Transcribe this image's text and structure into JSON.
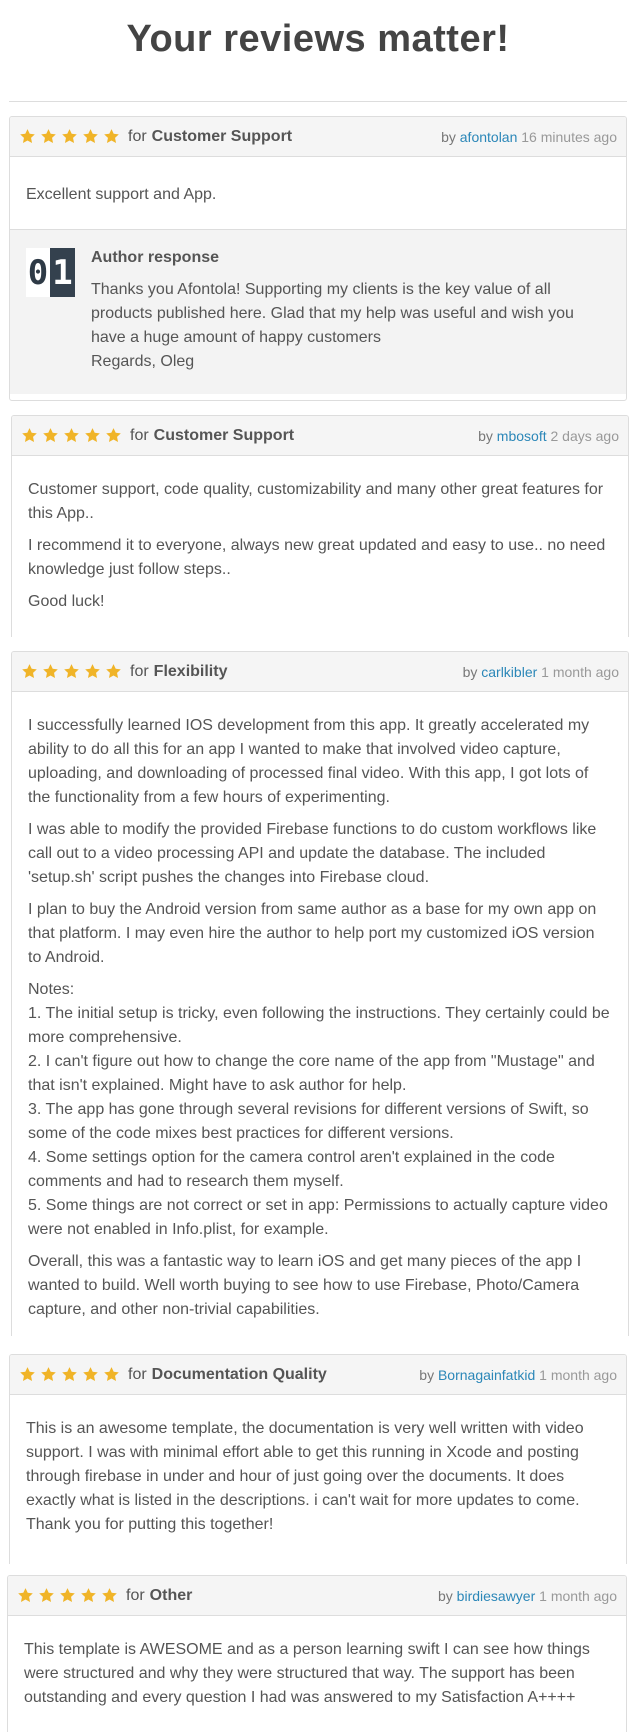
{
  "page": {
    "title": "Your reviews matter!"
  },
  "colors": {
    "star": "#f0b428",
    "link": "#2b87b8",
    "header_bg": "#f5f5f5",
    "response_bg": "#f3f3f3"
  },
  "reviews": [
    {
      "rating": 5,
      "for_label": "for",
      "category": "Customer Support",
      "by_label": "by",
      "author": "afontolan",
      "time": "16 minutes ago",
      "paragraphs": [
        "Excellent support and App."
      ],
      "response": {
        "title": "Author response",
        "avatar_text": [
          "0",
          "1"
        ],
        "text": "Thanks you Afontola! Supporting my clients is the key value of all products published here. Glad that my help was useful and wish you have a huge amount of happy customers",
        "signature": "Regards, Oleg"
      }
    },
    {
      "rating": 5,
      "for_label": "for",
      "category": "Customer Support",
      "by_label": "by",
      "author": "mbosoft",
      "time": "2 days ago",
      "paragraphs": [
        "Customer support, code quality, customizability and many other great features for this App..",
        "I recommend it to everyone, always new great updated and easy to use.. no need knowledge just follow steps..",
        "Good luck!"
      ]
    },
    {
      "rating": 5,
      "for_label": "for",
      "category": "Flexibility",
      "by_label": "by",
      "author": "carlkibler",
      "time": "1 month ago",
      "paragraphs": [
        "I successfully learned IOS development from this app. It greatly accelerated my ability to do all this for an app I wanted to make that involved video capture, uploading, and downloading of processed final video. With this app, I got lots of the functionality from a few hours of experimenting.",
        "I was able to modify the provided Firebase functions to do custom workflows like call out to a video processing API and update the database. The included 'setup.sh' script pushes the changes into Firebase cloud.",
        "I plan to buy the Android version from same author as a base for my own app on that platform. I may even hire the author to help port my customized iOS version to Android."
      ],
      "notes": [
        "Notes:",
        "1. The initial setup is tricky, even following the instructions. They certainly could be more comprehensive.",
        "2. I can't figure out how to change the core name of the app from \"Mustage\" and that isn't explained. Might have to ask author for help.",
        "3. The app has gone through several revisions for different versions of Swift, so some of the code mixes best practices for different versions.",
        "4. Some settings option for the camera control aren't explained in the code comments and had to research them myself.",
        "5. Some things are not correct or set in app: Permissions to actually capture video were not enabled in Info.plist, for example."
      ],
      "closing": "Overall, this was a fantastic way to learn iOS and get many pieces of the app I wanted to build. Well worth buying to see how to use Firebase, Photo/Camera capture, and other non-trivial capabilities."
    },
    {
      "rating": 5,
      "for_label": "for",
      "category": "Documentation Quality",
      "by_label": "by",
      "author": "Bornagainfatkid",
      "time": "1 month ago",
      "paragraphs": [
        "This is an awesome template, the documentation is very well written with video support. I was with minimal effort able to get this running in Xcode and posting through firebase in under and hour of just going over the documents. It does exactly what is listed in the descriptions. i can't wait for more updates to come. Thank you for putting this together!"
      ]
    },
    {
      "rating": 5,
      "for_label": "for",
      "category": "Other",
      "by_label": "by",
      "author": "birdiesawyer",
      "time": "1 month ago",
      "paragraphs": [
        "This template is AWESOME and as a person learning swift I can see how things were structured and why they were structured that way. The support has been outstanding and every question I had was answered to my Satisfaction A++++"
      ]
    }
  ]
}
